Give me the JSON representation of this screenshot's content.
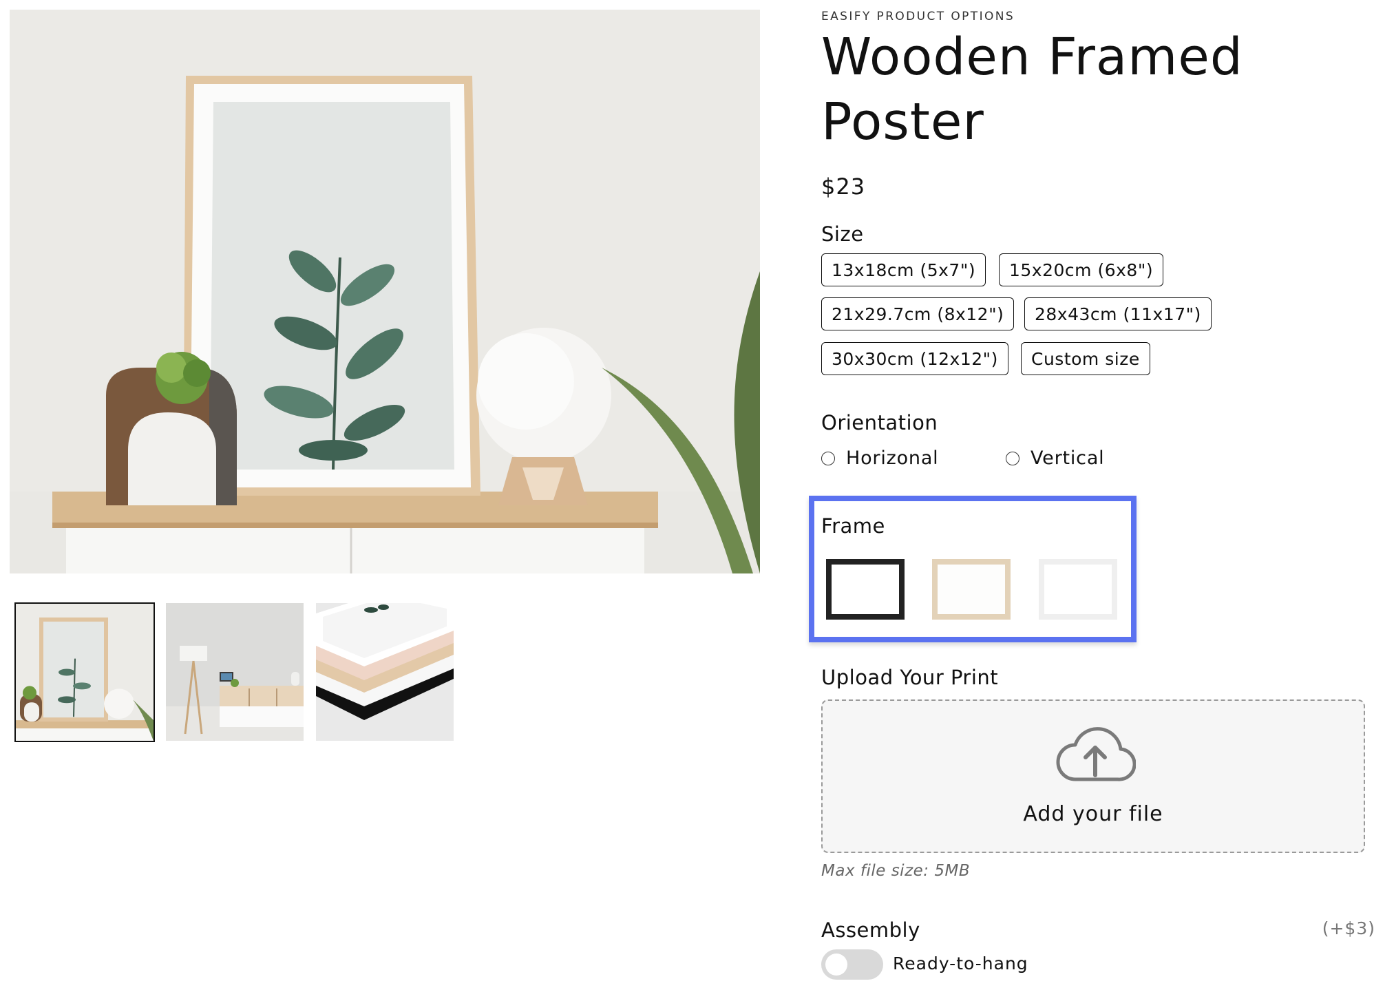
{
  "gallery": {
    "main_image_name": "framed-poster-on-sideboard",
    "thumbnails": [
      {
        "name": "framed-poster-on-sideboard",
        "selected": true
      },
      {
        "name": "living-room-wall",
        "selected": false
      },
      {
        "name": "stacked-frames",
        "selected": false
      }
    ]
  },
  "product": {
    "vendor": "EASIFY PRODUCT OPTIONS",
    "title": "Wooden Framed Poster",
    "price": "$23"
  },
  "options": {
    "size": {
      "label": "Size",
      "choices": [
        "13x18cm (5x7\")",
        "15x20cm (6x8\")",
        "21x29.7cm (8x12\")",
        "28x43cm (11x17\")",
        "30x30cm (12x12\")",
        "Custom size"
      ]
    },
    "orientation": {
      "label": "Orientation",
      "choices": [
        "Horizonal",
        "Vertical"
      ]
    },
    "frame": {
      "label": "Frame",
      "swatches": [
        {
          "name": "black-frame",
          "color": "#222222"
        },
        {
          "name": "natural-wood-frame",
          "color": "#e3d2b8"
        },
        {
          "name": "white-frame",
          "color": "#efefef"
        }
      ],
      "highlight_color": "#5b72f0"
    },
    "upload": {
      "label": "Upload Your Print",
      "button_text": "Add your file",
      "icon": "cloud-upload-icon",
      "hint": "Max file size: 5MB"
    },
    "assembly": {
      "label": "Assembly",
      "price_addon": "(+$3)",
      "toggle_label": "Ready-to-hang",
      "enabled": false
    }
  }
}
